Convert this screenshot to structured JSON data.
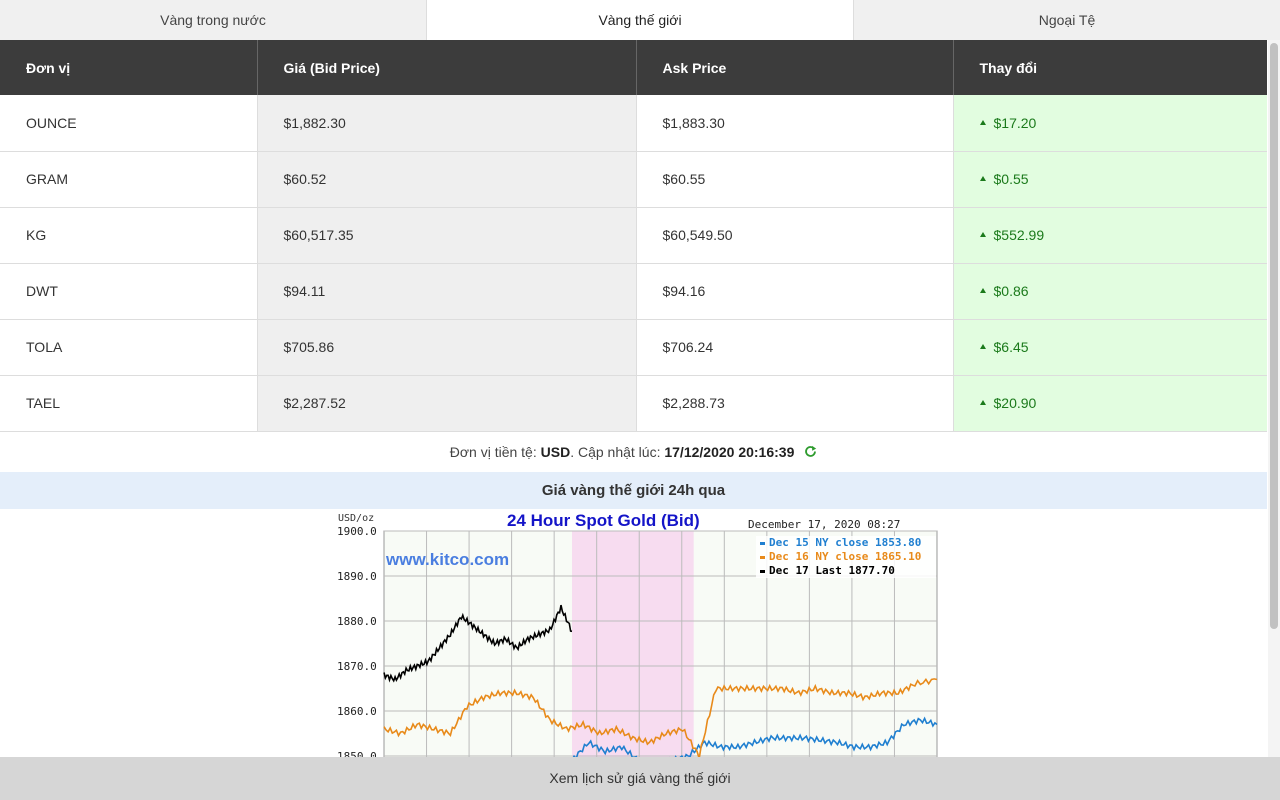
{
  "tabs": [
    {
      "label": "Vàng trong nước",
      "active": false
    },
    {
      "label": "Vàng thế giới",
      "active": true
    },
    {
      "label": "Ngoại Tệ",
      "active": false
    }
  ],
  "table": {
    "headers": [
      "Đơn vị",
      "Giá (Bid Price)",
      "Ask Price",
      "Thay đổi"
    ],
    "rows": [
      {
        "unit": "OUNCE",
        "bid": "$1,882.30",
        "ask": "$1,883.30",
        "change": "$17.20",
        "direction": "up"
      },
      {
        "unit": "GRAM",
        "bid": "$60.52",
        "ask": "$60.55",
        "change": "$0.55",
        "direction": "up"
      },
      {
        "unit": "KG",
        "bid": "$60,517.35",
        "ask": "$60,549.50",
        "change": "$552.99",
        "direction": "up"
      },
      {
        "unit": "DWT",
        "bid": "$94.11",
        "ask": "$94.16",
        "change": "$0.86",
        "direction": "up"
      },
      {
        "unit": "TOLA",
        "bid": "$705.86",
        "ask": "$706.24",
        "change": "$6.45",
        "direction": "up"
      },
      {
        "unit": "TAEL",
        "bid": "$2,287.52",
        "ask": "$2,288.73",
        "change": "$20.90",
        "direction": "up"
      }
    ]
  },
  "update": {
    "currency_label": "Đơn vị tiền tệ: ",
    "currency": "USD",
    "updated_label": ". Cập nhật lúc: ",
    "updated_at": "17/12/2020 20:16:39",
    "refresh_icon": "refresh-icon"
  },
  "section_title": "Giá vàng thế giới 24h qua",
  "chart_data": {
    "type": "line",
    "title": "24 Hour Spot Gold (Bid)",
    "unit_label": "USD/oz",
    "timestamp": "December 17, 2020 08:27",
    "watermark": "www.kitco.com",
    "ylim": [
      1848,
      1900
    ],
    "yticks": [
      "1900.0",
      "1890.0",
      "1880.0",
      "1870.0",
      "1860.0",
      "1850.0"
    ],
    "grid": true,
    "legend_position": "top-right",
    "series": [
      {
        "name": "Dec 15 NY close 1853.80",
        "color": "#1f7fd0",
        "x": [
          0.34,
          0.37,
          0.4,
          0.43,
          0.46,
          0.49,
          0.52,
          0.55,
          0.58,
          0.61,
          0.64,
          0.67,
          0.7,
          0.73,
          0.76,
          0.79,
          0.82,
          0.85,
          0.88,
          0.91,
          0.94,
          0.97,
          1.0
        ],
        "y": [
          1849,
          1853,
          1851,
          1852,
          1849,
          1848,
          1849,
          1850,
          1853,
          1852,
          1852,
          1853,
          1854,
          1854,
          1854,
          1853.5,
          1853,
          1852,
          1852,
          1853,
          1857,
          1858,
          1857
        ]
      },
      {
        "name": "Dec 16 NY close 1865.10",
        "color": "#e88a1a",
        "x": [
          0.0,
          0.03,
          0.06,
          0.09,
          0.12,
          0.15,
          0.18,
          0.21,
          0.24,
          0.27,
          0.3,
          0.33,
          0.36,
          0.39,
          0.42,
          0.45,
          0.48,
          0.51,
          0.54,
          0.57,
          0.6,
          0.63,
          0.66,
          0.69,
          0.72,
          0.75,
          0.78,
          0.81,
          0.84,
          0.87,
          0.9,
          0.93,
          0.96,
          1.0
        ],
        "y": [
          1856,
          1855,
          1857,
          1856,
          1855,
          1861,
          1863,
          1864,
          1864,
          1863,
          1858,
          1856,
          1857,
          1855,
          1856,
          1854,
          1853,
          1855,
          1856,
          1850,
          1865,
          1865,
          1865,
          1865,
          1865,
          1864,
          1865,
          1864,
          1864,
          1863,
          1864,
          1864,
          1866,
          1867
        ]
      },
      {
        "name": "Dec 17 Last 1877.70",
        "color": "#000000",
        "x": [
          0.0,
          0.02,
          0.04,
          0.06,
          0.08,
          0.1,
          0.12,
          0.14,
          0.16,
          0.18,
          0.2,
          0.22,
          0.24,
          0.26,
          0.28,
          0.3,
          0.32,
          0.34
        ],
        "y": [
          1868,
          1867,
          1869,
          1870,
          1871,
          1874,
          1877,
          1881,
          1879,
          1877,
          1875,
          1876,
          1874,
          1876,
          1877,
          1878,
          1883,
          1877.7
        ]
      }
    ],
    "highlight_range": [
      0.34,
      0.56
    ]
  },
  "history_button": "Xem lịch sử giá vàng thế giới"
}
